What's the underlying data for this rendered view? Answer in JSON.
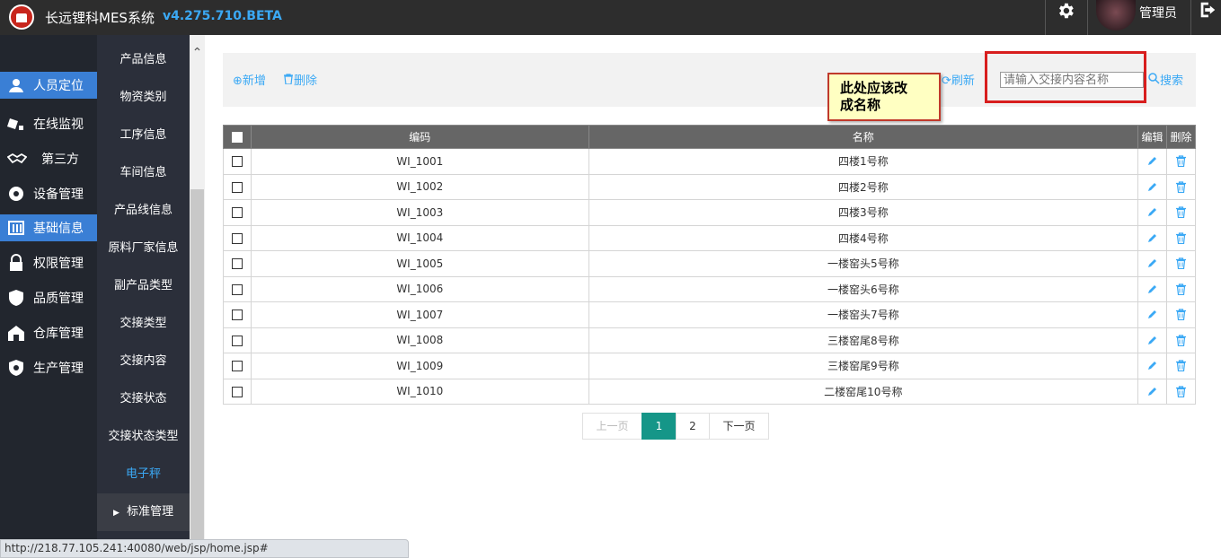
{
  "header": {
    "app_title": "长远锂科MES系统",
    "version": "v4.275.710.BETA",
    "user_name": "管理员",
    "settings_icon": "gear-icon",
    "logout_icon": "logout-icon"
  },
  "primary_nav": [
    {
      "label": "人员定位",
      "icon": "person-location-icon",
      "active": true
    },
    {
      "label": "在线监视",
      "icon": "monitor-icon",
      "active": false
    },
    {
      "label": "第三方",
      "icon": "handshake-icon",
      "active": false
    },
    {
      "label": "设备管理",
      "icon": "device-icon",
      "active": false
    },
    {
      "label": "基础信息",
      "icon": "list-icon",
      "active": true
    },
    {
      "label": "权限管理",
      "icon": "lock-icon",
      "active": false
    },
    {
      "label": "品质管理",
      "icon": "shield-icon",
      "active": false
    },
    {
      "label": "仓库管理",
      "icon": "warehouse-icon",
      "active": false
    },
    {
      "label": "生产管理",
      "icon": "gear-shield-icon",
      "active": false
    }
  ],
  "secondary_nav": [
    {
      "label": "产品信息"
    },
    {
      "label": "物资类别"
    },
    {
      "label": "工序信息"
    },
    {
      "label": "车间信息"
    },
    {
      "label": "产品线信息"
    },
    {
      "label": "原料厂家信息"
    },
    {
      "label": "副产品类型"
    },
    {
      "label": "交接类型"
    },
    {
      "label": "交接内容"
    },
    {
      "label": "交接状态"
    },
    {
      "label": "交接状态类型"
    },
    {
      "label": "电子秤",
      "current": true
    },
    {
      "label": "标准管理",
      "group": true
    }
  ],
  "toolbar": {
    "add_label": "新增",
    "delete_label": "删除",
    "refresh_label": "刷新",
    "search_label": "搜索",
    "search_placeholder": "请输入交接内容名称"
  },
  "annotation_note": "此处应该改\n成名称",
  "table": {
    "headers": {
      "code": "编码",
      "name": "名称",
      "edit": "编辑",
      "delete": "删除"
    },
    "rows": [
      {
        "code": "WI_1001",
        "name": "四楼1号称"
      },
      {
        "code": "WI_1002",
        "name": "四楼2号称"
      },
      {
        "code": "WI_1003",
        "name": "四楼3号称"
      },
      {
        "code": "WI_1004",
        "name": "四楼4号称"
      },
      {
        "code": "WI_1005",
        "name": "一楼窑头5号称"
      },
      {
        "code": "WI_1006",
        "name": "一楼窑头6号称"
      },
      {
        "code": "WI_1007",
        "name": "一楼窑头7号称"
      },
      {
        "code": "WI_1008",
        "name": "三楼窑尾8号称"
      },
      {
        "code": "WI_1009",
        "name": "三楼窑尾9号称"
      },
      {
        "code": "WI_1010",
        "name": "二楼窑尾10号称"
      }
    ]
  },
  "pagination": {
    "prev_label": "上一页",
    "pages": [
      "1",
      "2"
    ],
    "current_page": "1",
    "next_label": "下一页"
  },
  "status_bar": {
    "url": "http://218.77.105.241:40080/web/jsp/home.jsp#"
  },
  "colors": {
    "accent": "#3ba9f5",
    "active_nav": "#3a7fd5",
    "pager_active": "#159688",
    "highlight_border": "#d81e1e"
  }
}
